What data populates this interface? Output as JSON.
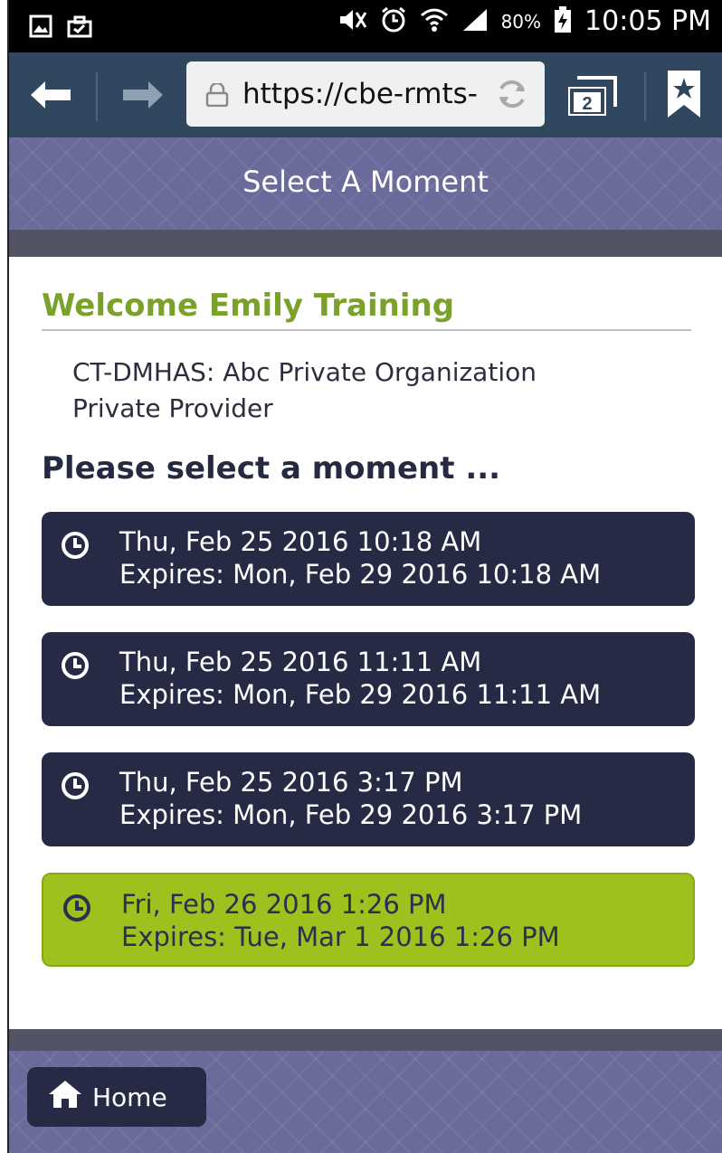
{
  "status_bar": {
    "battery_percent": "80%",
    "time": "10:05 PM",
    "icons": [
      "gallery-icon",
      "briefcase-icon",
      "mute-icon",
      "alarm-icon",
      "wifi-icon",
      "signal-icon",
      "battery-charging-icon"
    ]
  },
  "browser": {
    "url": "https://cbe-rmts-",
    "tab_count": "2",
    "icons": [
      "back-arrow-icon",
      "forward-arrow-icon",
      "lock-icon",
      "reload-icon",
      "tabs-icon",
      "bookmark-icon"
    ]
  },
  "header": {
    "title": "Select A Moment"
  },
  "welcome": "Welcome Emily Training",
  "organization": {
    "line1": "CT-DMHAS: Abc Private Organization",
    "line2": "Private Provider"
  },
  "prompt": "Please select a moment ...",
  "moments": [
    {
      "date": "Thu, Feb 25 2016 10:18 AM",
      "expires": "Expires: Mon, Feb 29 2016 10:18 AM",
      "selected": false
    },
    {
      "date": "Thu, Feb 25 2016 11:11 AM",
      "expires": "Expires: Mon, Feb 29 2016 11:11 AM",
      "selected": false
    },
    {
      "date": "Thu, Feb 25 2016 3:17 PM",
      "expires": "Expires: Mon, Feb 29 2016 3:17 PM",
      "selected": false
    },
    {
      "date": "Fri, Feb 26 2016 1:26 PM",
      "expires": "Expires: Tue, Mar 1 2016 1:26 PM",
      "selected": true
    }
  ],
  "footer": {
    "home_label": "Home"
  },
  "colors": {
    "brand_purple": "#6a6a9b",
    "dark_navy": "#262a44",
    "accent_green": "#9ec11d",
    "welcome_green": "#7aa12a",
    "browser_bar": "#31475f"
  }
}
